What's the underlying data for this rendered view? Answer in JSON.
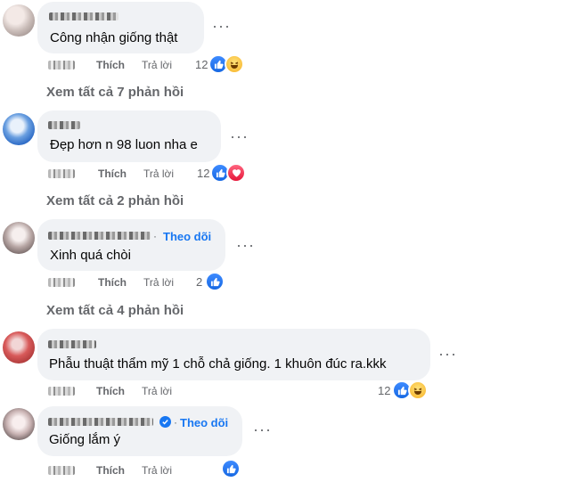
{
  "actions": {
    "like": "Thích",
    "reply": "Trả lời"
  },
  "comments": [
    {
      "text": "Công nhận giống thật",
      "reaction_count": "12",
      "reactions": [
        "like-icon",
        "haha-icon"
      ],
      "view_replies": "Xem tất cả 7 phản hồi"
    },
    {
      "text": "Đẹp hơn n 98 luon nha e",
      "reaction_count": "12",
      "reactions": [
        "like-icon",
        "love-icon"
      ],
      "view_replies": "Xem tất cả 2 phản hồi"
    },
    {
      "follow": "Theo dõi",
      "text": "Xinh quá chòi",
      "reaction_count": "2",
      "reactions": [
        "like-icon"
      ],
      "view_replies": "Xem tất cả 4 phản hồi"
    },
    {
      "text": "Phẫu thuật thẩm mỹ 1 chỗ chả giống. 1 khuôn đúc ra.kkk",
      "reaction_count": "12",
      "reactions": [
        "like-icon",
        "haha-icon"
      ]
    },
    {
      "follow": "Theo dõi",
      "verified": true,
      "text": "Giống lắm ý",
      "reactions": [
        "like-icon"
      ]
    }
  ],
  "colors": {
    "link": "#1877f2",
    "secondary": "#65676b",
    "bubble": "#f0f2f5",
    "like": "#1877f2"
  }
}
